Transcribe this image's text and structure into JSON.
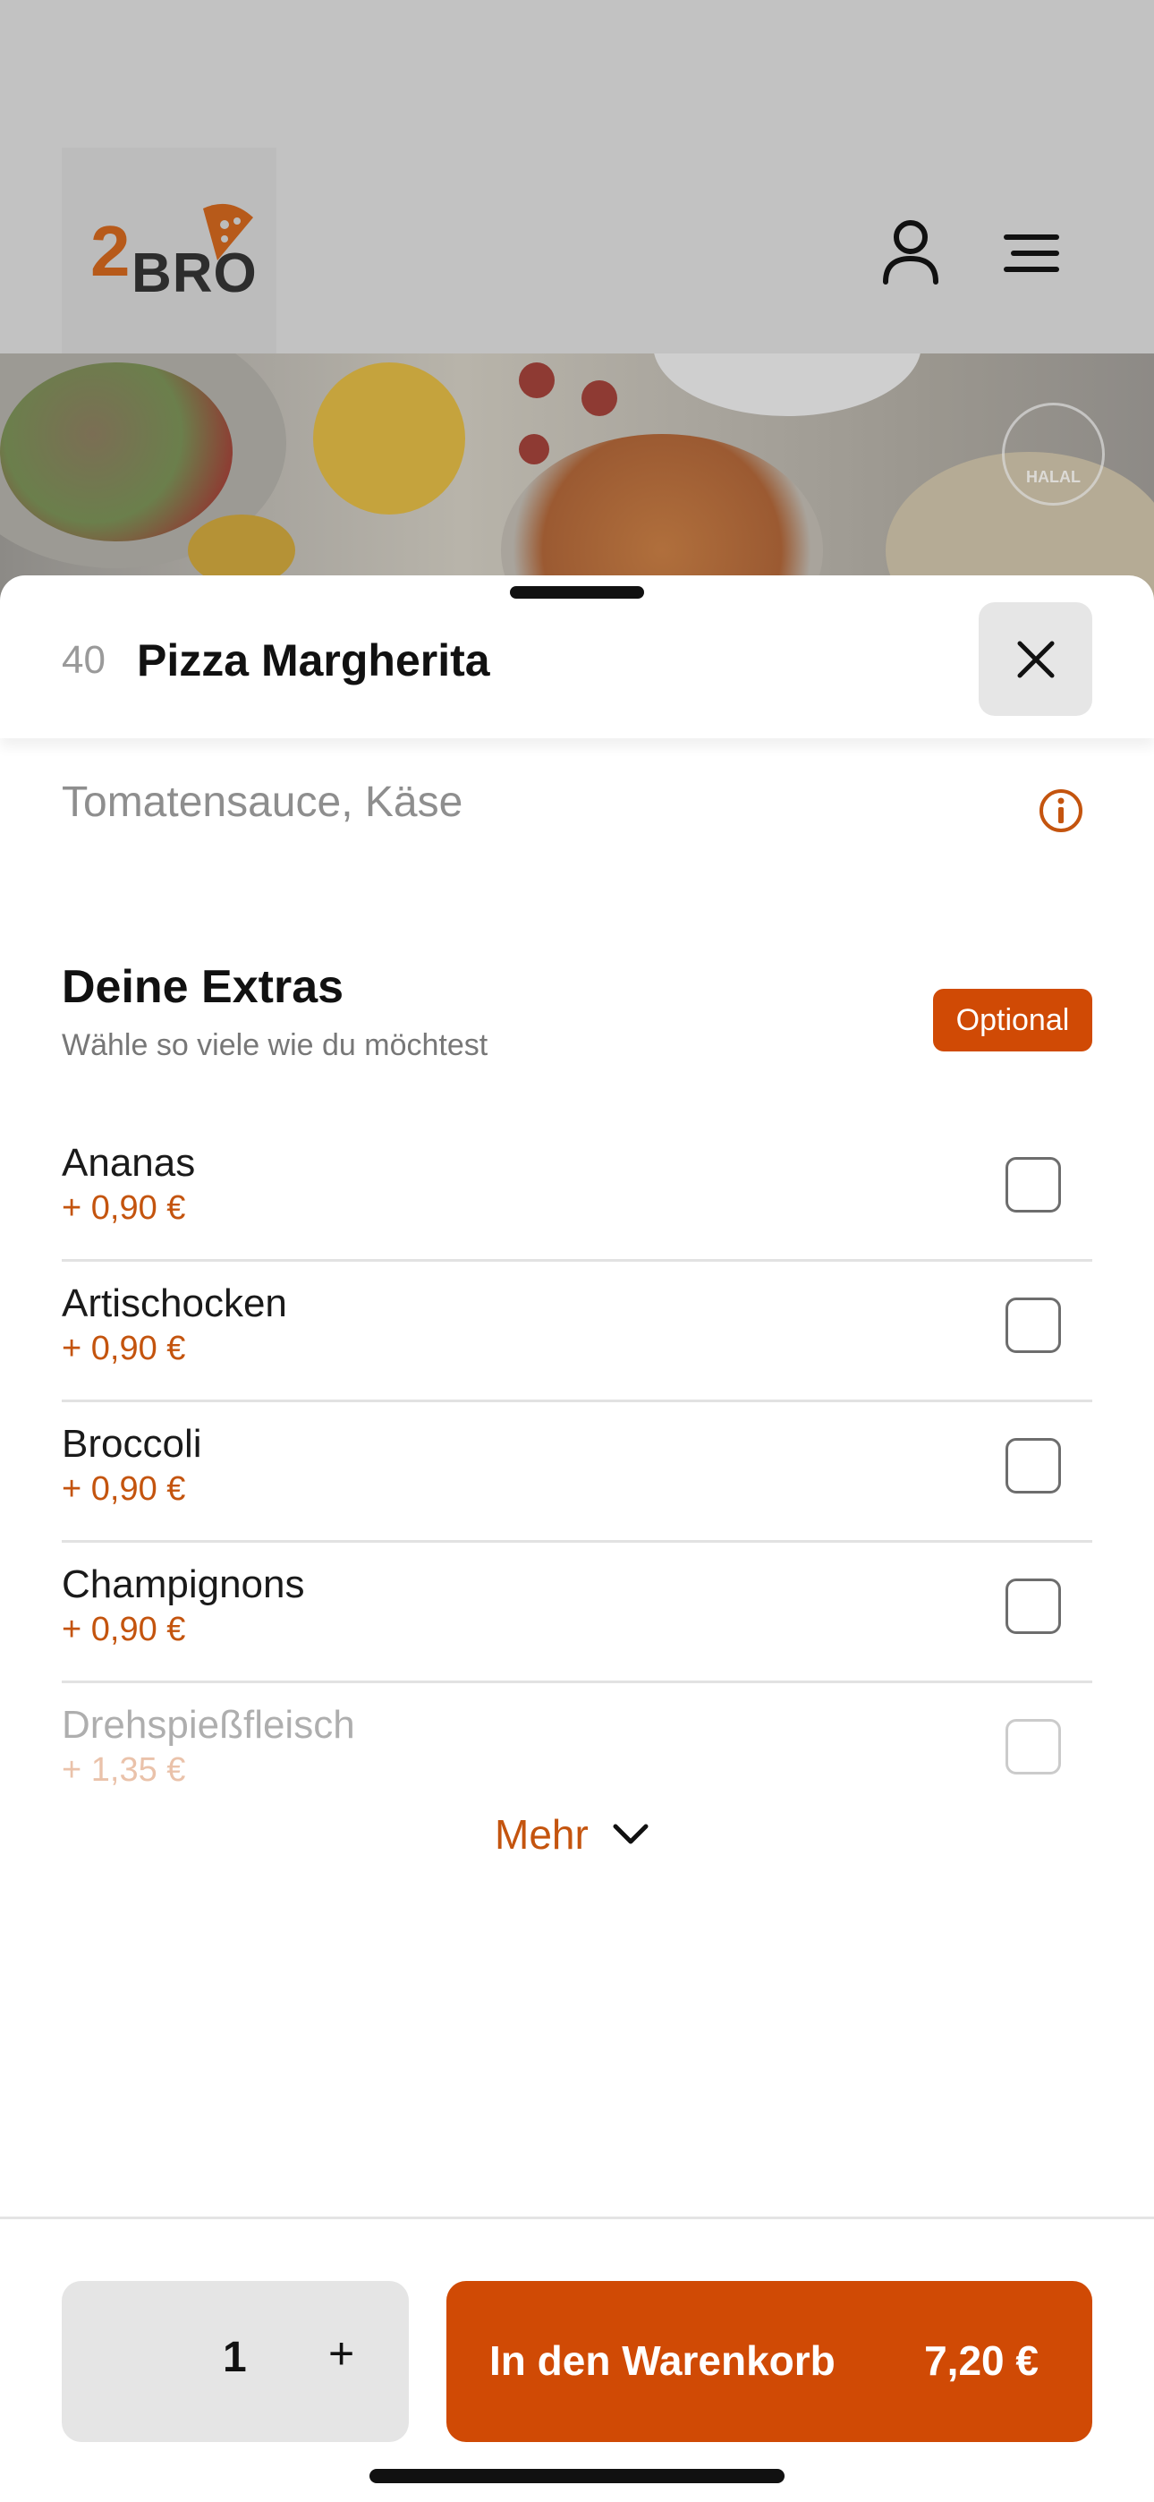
{
  "header": {
    "logo_number": "2",
    "logo_text": "BRO"
  },
  "hero": {
    "halal_badge": "HALAL"
  },
  "item": {
    "number": "40",
    "title": "Pizza Margherita",
    "description": "Tomatensauce, Käse"
  },
  "extras": {
    "title": "Deine Extras",
    "subtitle": "Wähle so viele wie du möchtest",
    "badge": "Optional",
    "items": [
      {
        "name": "Ananas",
        "price": "+ 0,90 €"
      },
      {
        "name": "Artischocken",
        "price": "+ 0,90 €"
      },
      {
        "name": "Broccoli",
        "price": "+ 0,90 €"
      },
      {
        "name": "Champignons",
        "price": "+ 0,90 €"
      },
      {
        "name": "Drehspießfleisch",
        "price": "+ 1,35 €"
      }
    ],
    "more_label": "Mehr"
  },
  "footer": {
    "quantity": "1",
    "plus": "+",
    "cart_label": "In den Warenkorb",
    "cart_price": "7,20 €"
  },
  "colors": {
    "accent": "#d04a05",
    "price_text": "#c4540e"
  }
}
